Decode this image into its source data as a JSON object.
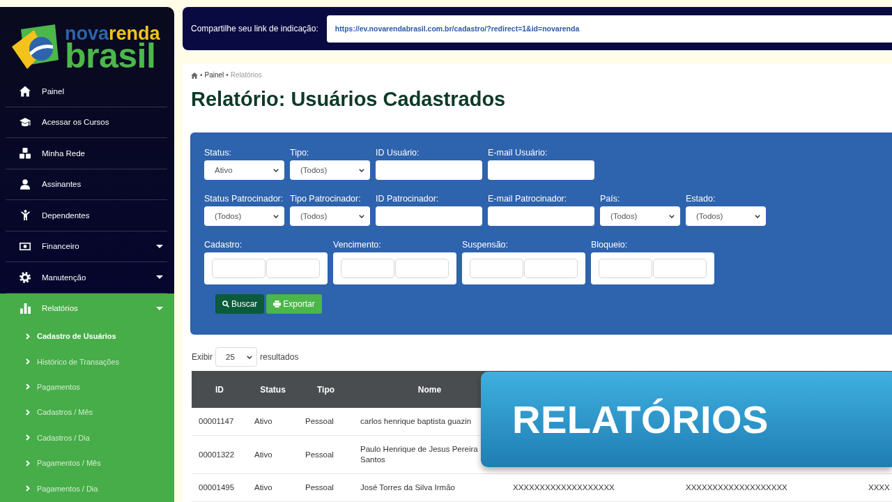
{
  "sidebar": {
    "logo": {
      "top_line": [
        "nova",
        "renda"
      ],
      "bottom_line": "brasil"
    },
    "items": [
      {
        "label": "Painel",
        "kind": "link",
        "selected": false
      },
      {
        "label": "Acessar os Cursos",
        "kind": "link",
        "selected": false
      },
      {
        "label": "Minha Rede",
        "kind": "link",
        "selected": false
      },
      {
        "label": "Assinantes",
        "kind": "link",
        "selected": false
      },
      {
        "label": "Dependentes",
        "kind": "link",
        "selected": false
      },
      {
        "label": "Financeiro",
        "kind": "group",
        "selected": false
      },
      {
        "label": "Manutenção",
        "kind": "group",
        "selected": false
      },
      {
        "label": "Relatórios",
        "kind": "group",
        "selected": true,
        "children": [
          {
            "label": "Cadastro de Usuários",
            "selected": true
          },
          {
            "label": "Histórico de Transações",
            "selected": false
          },
          {
            "label": "Pagamentos",
            "selected": false
          },
          {
            "label": "Cadastros / Mês",
            "selected": false
          },
          {
            "label": "Cadastros / Dia",
            "selected": false
          },
          {
            "label": "Pagamentos / Mês",
            "selected": false
          },
          {
            "label": "Pagamentos / Dia",
            "selected": false
          }
        ]
      }
    ]
  },
  "referral_bar": {
    "label": "Compartilhe seu link de indicação:",
    "link": "https://ev.novarendabrasil.com.br/cadastro/?redirect=1&id=novarenda"
  },
  "breadcrumb": {
    "separator": "•",
    "items": [
      {
        "label": "Painel",
        "current": false
      },
      {
        "label": "Relatórios",
        "current": true
      }
    ]
  },
  "page_title": "Relatório: Usuários Cadastrados",
  "filters": {
    "user_fields": [
      {
        "kind": "select",
        "label": "Status:",
        "value": "Ativo"
      },
      {
        "kind": "select",
        "label": "Tipo:",
        "value": "(Todos)"
      },
      {
        "kind": "text",
        "label": "ID Usuário:"
      },
      {
        "kind": "text",
        "label": "E-mail Usuário:"
      }
    ],
    "sponsor_fields": [
      {
        "kind": "select",
        "label": "Status Patrocinador:",
        "value": "(Todos)"
      },
      {
        "kind": "select",
        "label": "Tipo Patrocinador:",
        "value": "(Todos)"
      },
      {
        "kind": "text",
        "label": "ID Patrocinador:"
      },
      {
        "kind": "text",
        "label": "E-mail Patrocinador:"
      },
      {
        "kind": "select",
        "label": "País:",
        "value": "(Todos)"
      },
      {
        "kind": "select",
        "label": "Estado:",
        "value": "(Todos)"
      }
    ],
    "date_fields": [
      {
        "kind": "date_range",
        "label": "Cadastro:"
      },
      {
        "kind": "date_range",
        "label": "Vencimento:"
      },
      {
        "kind": "date_range",
        "label": "Suspensão:"
      },
      {
        "kind": "date_range",
        "label": "Bloqueio:"
      }
    ],
    "buttons": [
      {
        "kind": "search",
        "label": "Buscar"
      },
      {
        "kind": "export",
        "label": "Exportar"
      }
    ]
  },
  "page_size": {
    "label": "Exibir",
    "value": "25",
    "suffix": "resultados"
  },
  "table": {
    "columns": [
      "ID",
      "Status",
      "Tipo",
      "Nome"
    ],
    "rows": [
      [
        "00001147",
        "Ativo",
        "Pessoal",
        "carlos henrique baptista guazin"
      ],
      [
        "00001322",
        "Ativo",
        "Pessoal",
        "Paulo Henrique de Jesus Pereira Santos"
      ],
      [
        "00001495",
        "Ativo",
        "Pessoal",
        "José Torres da Silva Irmão",
        "XXXXXXXXXXXXXXXXXXX",
        "XXXXXXXXXXXXXXXXXXX",
        "XXXX"
      ]
    ]
  },
  "overlay_banner": {
    "title": "RELATÓRIOS"
  }
}
